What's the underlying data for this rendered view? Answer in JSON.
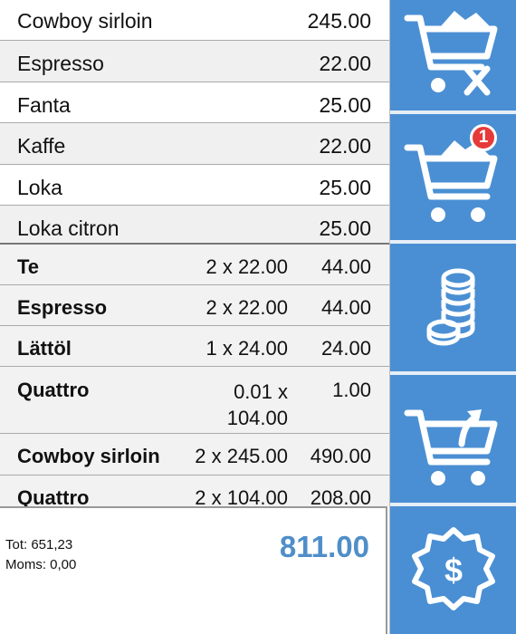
{
  "products": [
    {
      "name": "Cowboy sirloin",
      "price": "245.00"
    },
    {
      "name": "Espresso",
      "price": "22.00"
    },
    {
      "name": "Fanta",
      "price": "25.00"
    },
    {
      "name": "Kaffe",
      "price": "22.00"
    },
    {
      "name": "Loka",
      "price": "25.00"
    },
    {
      "name": "Loka citron",
      "price": "25.00"
    }
  ],
  "order_lines": [
    {
      "name": "Te",
      "qty": "2 x 22.00",
      "total": "44.00"
    },
    {
      "name": "Espresso",
      "qty": "2 x 22.00",
      "total": "44.00"
    },
    {
      "name": "Lättöl",
      "qty": "1 x 24.00",
      "total": "24.00"
    },
    {
      "name": "Quattro",
      "qty": "0.01 x 104.00",
      "total": "1.00"
    },
    {
      "name": "Cowboy sirloin",
      "qty": "2 x 245.00",
      "total": "490.00"
    },
    {
      "name": "Quattro",
      "qty": "2 x 104.00",
      "total": "208.00"
    }
  ],
  "summary": {
    "tot": "Tot: 651,23",
    "moms": "Moms: 0,00",
    "grand_total": "811.00"
  },
  "actions": {
    "cart_badge": "1",
    "icons": [
      "clear-cart-icon",
      "cart-icon",
      "coins-icon",
      "return-cart-icon",
      "payment-icon"
    ]
  },
  "colors": {
    "action_blue": "#4a8fd3",
    "total_blue": "#4f8ec9",
    "badge_red": "#e63a3a"
  }
}
